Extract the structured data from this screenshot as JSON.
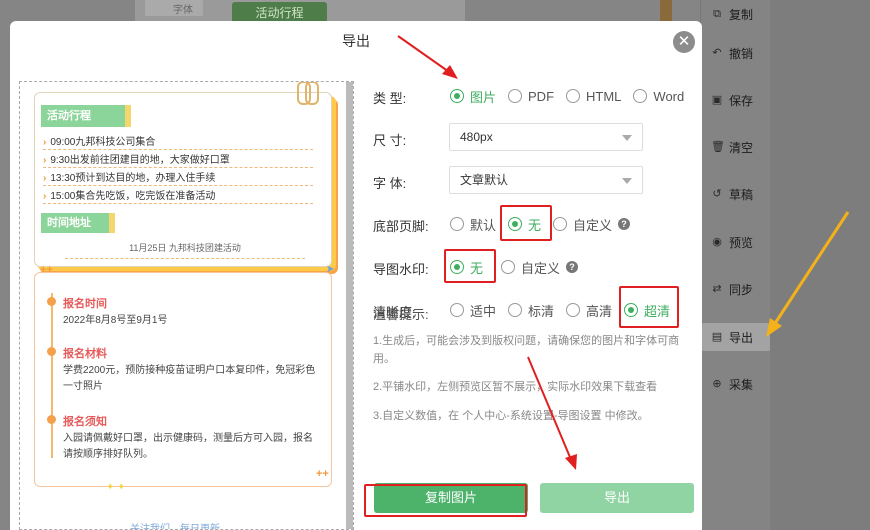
{
  "background": {
    "tag_label": "活动行程",
    "thumb_label": "字体"
  },
  "toolbar": {
    "items": [
      {
        "label": "复制",
        "icon": "copy-icon"
      },
      {
        "label": "撤销",
        "icon": "undo-icon"
      },
      {
        "label": "保存",
        "icon": "save-icon"
      },
      {
        "label": "清空",
        "icon": "trash-icon"
      },
      {
        "label": "草稿",
        "icon": "draft-icon"
      },
      {
        "label": "预览",
        "icon": "eye-icon"
      },
      {
        "label": "同步",
        "icon": "sync-icon"
      },
      {
        "label": "导出",
        "icon": "export-icon"
      },
      {
        "label": "采集",
        "icon": "collect-icon"
      }
    ]
  },
  "modal": {
    "title": "导出",
    "close_icon": "close-icon"
  },
  "preview": {
    "header1": "活动行程",
    "schedule": [
      "09:00九邦科技公司集合",
      "9:30出发前往团建目的地，大家做好口罩",
      "13:30预计到达目的地，办理入住手续",
      "15:00集合先吃饭，吃完饭在准备活动"
    ],
    "header2": "时间地址",
    "card1_footer": "11月25日  九邦科技团建活动",
    "sections": [
      {
        "title": "报名时间",
        "body": "2022年8月8号至9月1号"
      },
      {
        "title": "报名材料",
        "body": "学费2200元，预防接种疫苗证明户口本复印件，免冠彩色一寸照片"
      },
      {
        "title": "报名须知",
        "body": "入园请佩戴好口罩，出示健康码，测量后方可入园，报名请按顺序排好队列。"
      }
    ],
    "footer": "关注我们，每日更新"
  },
  "form": {
    "type_label": "类    型:",
    "type_options": [
      "图片",
      "PDF",
      "HTML",
      "Word"
    ],
    "type_selected": "图片",
    "size_label": "尺    寸:",
    "size_value": "480px",
    "font_label": "字    体:",
    "font_value": "文章默认",
    "footer_label": "底部页脚:",
    "footer_options": [
      "默认",
      "无",
      "自定义"
    ],
    "footer_selected": "无",
    "watermark_label": "导图水印:",
    "watermark_options": [
      "无",
      "自定义"
    ],
    "watermark_selected": "无",
    "clarity_label": "清晰度:",
    "clarity_options": [
      "适中",
      "标清",
      "高清",
      "超清"
    ],
    "clarity_selected": "超清",
    "tips_title": "温馨提示:",
    "tips": [
      "1.生成后，可能会涉及到版权问题，请确保您的图片和字体可商用。",
      "2.平铺水印，左侧预览区暂不展示，实际水印效果下载查看",
      "3.自定义数值，在 个人中心-系统设置-导图设置 中修改。"
    ]
  },
  "buttons": {
    "copy_image": "复制图片",
    "export": "导出"
  },
  "colors": {
    "accent_green": "#3fae5f",
    "highlight_red": "#e02020",
    "annotation_yellow": "#f5b11a"
  }
}
